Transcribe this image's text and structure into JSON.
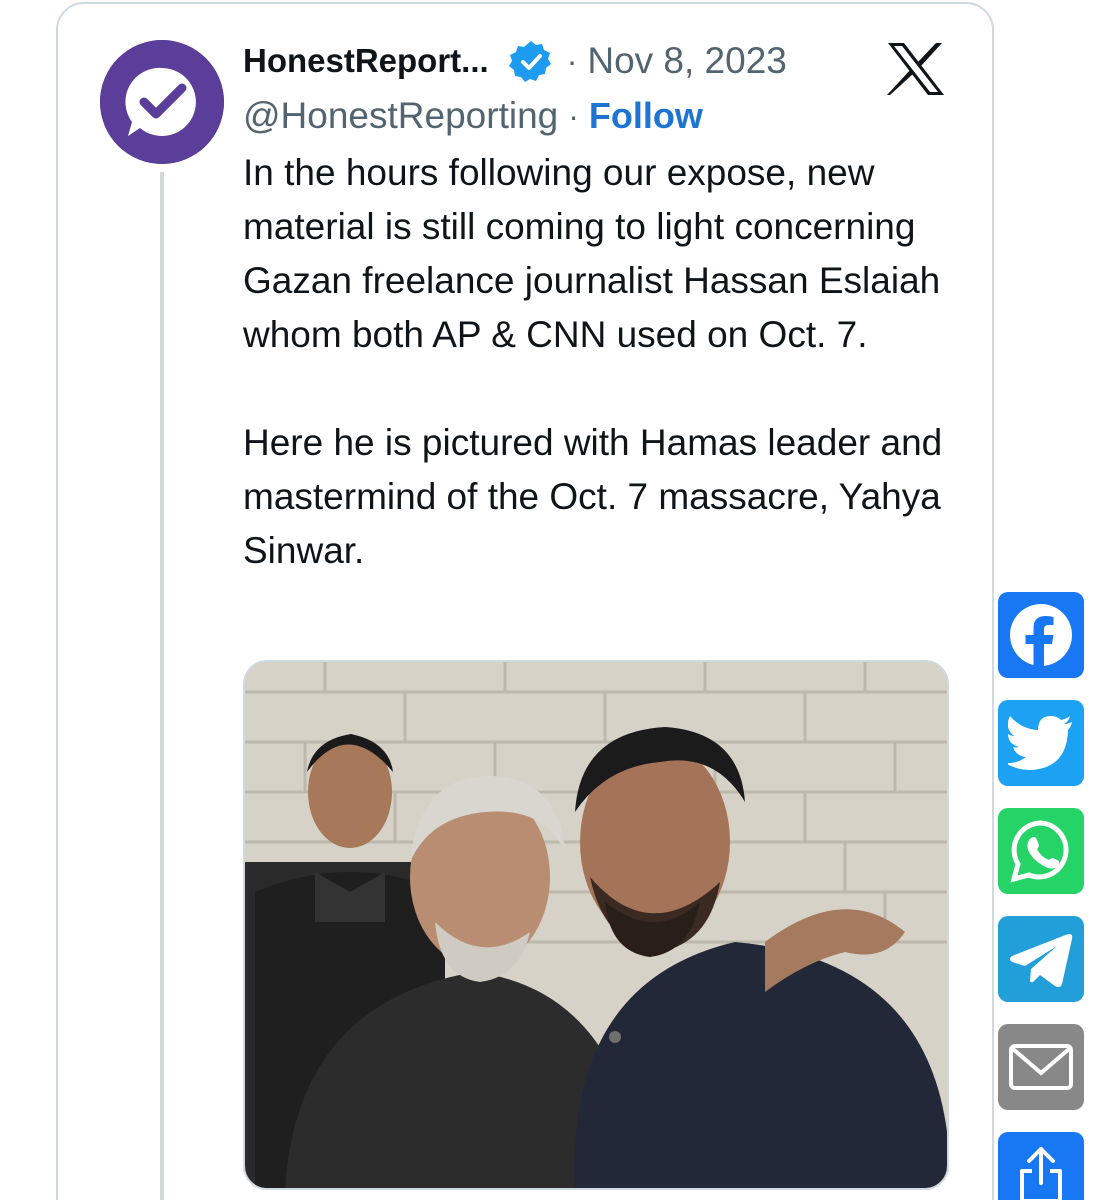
{
  "tweet": {
    "author_name": "HonestReport...",
    "handle": "@HonestReporting",
    "date": "Nov 8, 2023",
    "separator": "·",
    "follow_label": "Follow",
    "text_paragraphs": [
      "In the hours following our expose, new material is still coming to light concerning Gazan freelance journalist Hassan Eslaiah whom both AP & CNN used on Oct. 7.",
      "Here he is pictured with Hamas leader and mastermind of the Oct. 7 massacre, Yahya Sinwar."
    ],
    "avatar_icon": "checkmark-speech-bubble-icon",
    "verified_icon": "verified-badge-icon",
    "platform_icon": "x-logo-icon",
    "media_icon": "photo-image"
  },
  "share_bar": [
    {
      "name": "facebook",
      "icon": "facebook-icon",
      "color": "#1877f2"
    },
    {
      "name": "twitter",
      "icon": "twitter-bird-icon",
      "color": "#1da1f2"
    },
    {
      "name": "whatsapp",
      "icon": "whatsapp-icon",
      "color": "#25d366"
    },
    {
      "name": "telegram",
      "icon": "telegram-icon",
      "color": "#229ed9"
    },
    {
      "name": "email",
      "icon": "email-icon",
      "color": "#888888"
    },
    {
      "name": "share",
      "icon": "share-icon",
      "color": "#1877f2"
    }
  ],
  "colors": {
    "follow": "#1d74d1",
    "secondary_text": "#536471",
    "border": "#cfd9de",
    "avatar_bg": "#5a3e99"
  }
}
